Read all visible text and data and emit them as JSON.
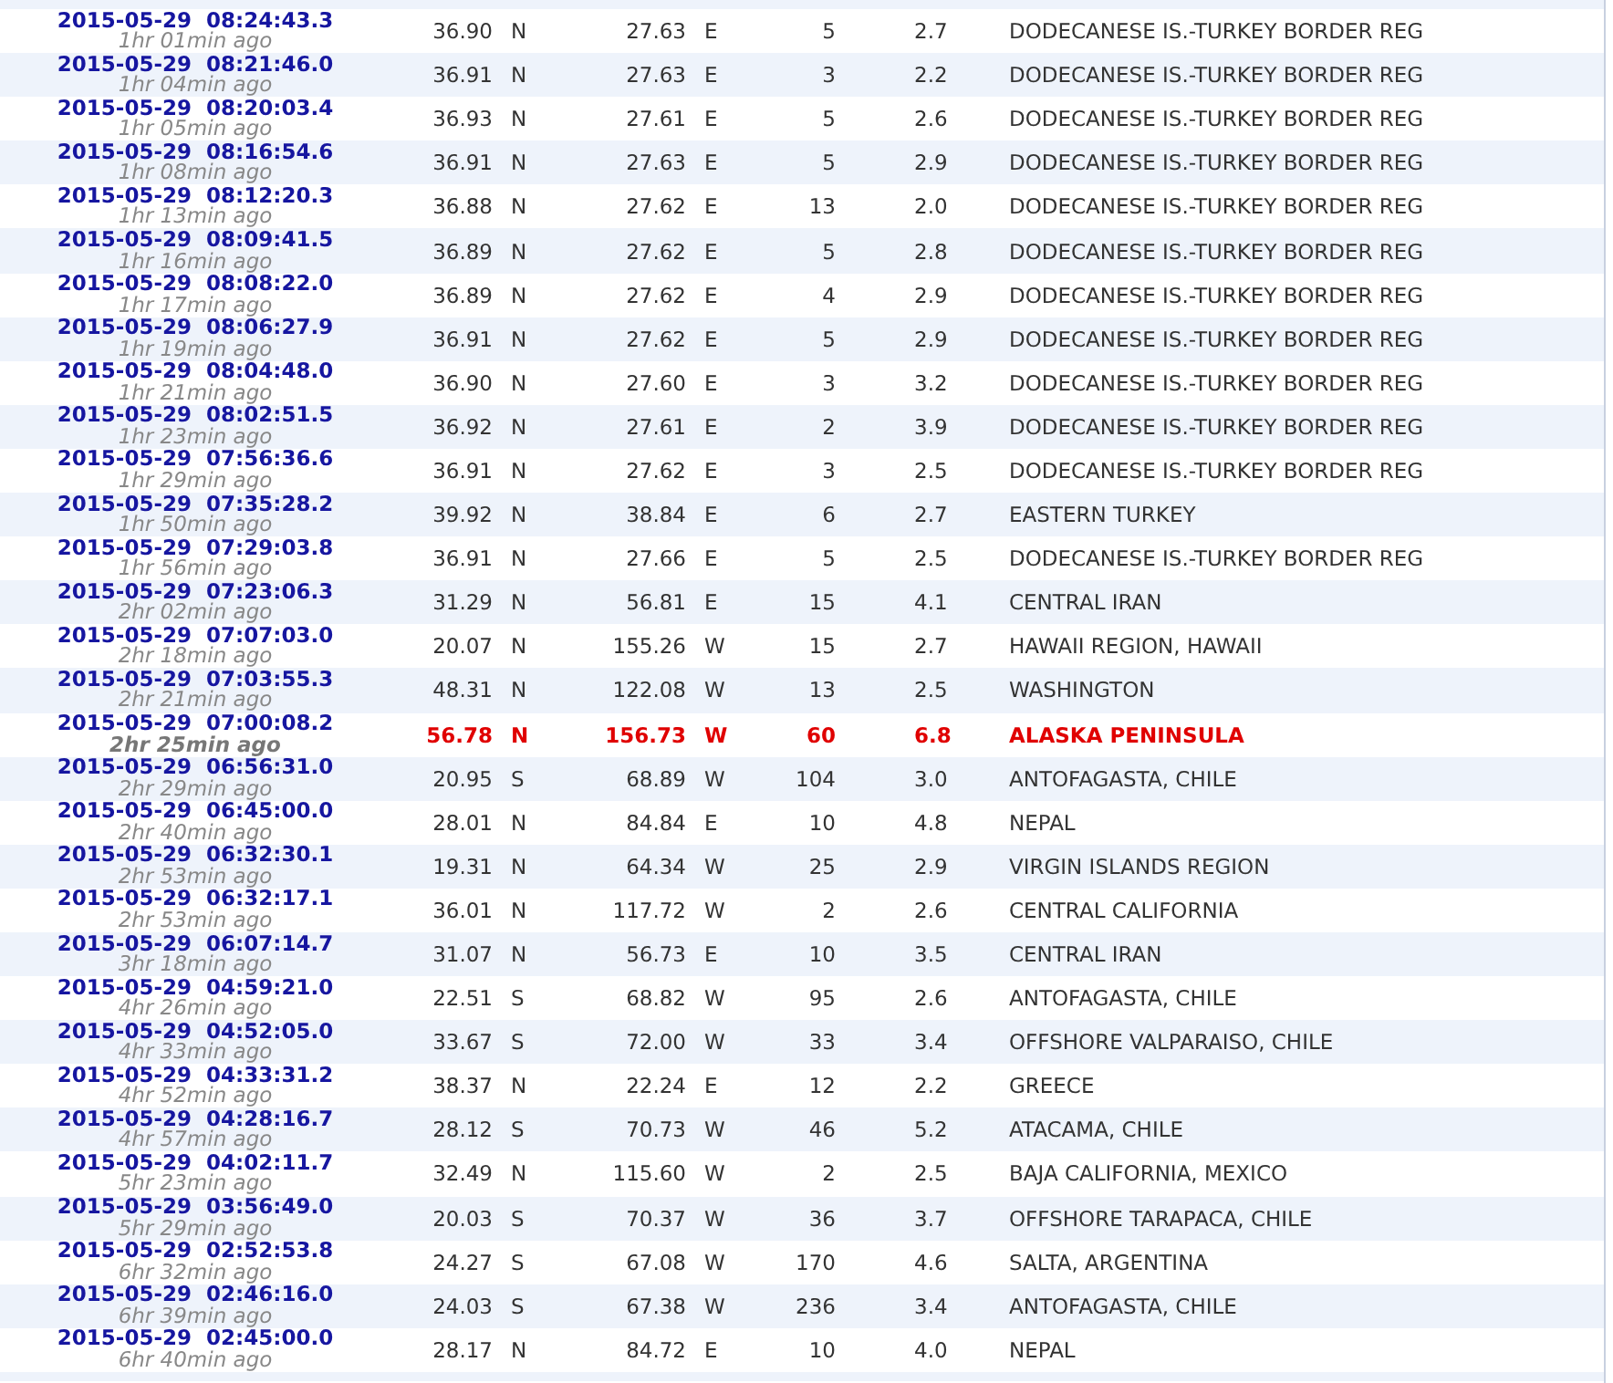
{
  "rows": [
    {
      "time": "2015-05-29  08:24:43.3",
      "ago": "1hr 01min ago",
      "lat": "36.90",
      "lat_dir": "N",
      "lon": "27.63",
      "lon_dir": "E",
      "depth": "5",
      "mag": "2.7",
      "region": "DODECANESE IS.-TURKEY BORDER REG",
      "highlighted": false
    },
    {
      "time": "2015-05-29  08:21:46.0",
      "ago": "1hr 04min ago",
      "lat": "36.91",
      "lat_dir": "N",
      "lon": "27.63",
      "lon_dir": "E",
      "depth": "3",
      "mag": "2.2",
      "region": "DODECANESE IS.-TURKEY BORDER REG",
      "highlighted": false
    },
    {
      "time": "2015-05-29  08:20:03.4",
      "ago": "1hr 05min ago",
      "lat": "36.93",
      "lat_dir": "N",
      "lon": "27.61",
      "lon_dir": "E",
      "depth": "5",
      "mag": "2.6",
      "region": "DODECANESE IS.-TURKEY BORDER REG",
      "highlighted": false
    },
    {
      "time": "2015-05-29  08:16:54.6",
      "ago": "1hr 08min ago",
      "lat": "36.91",
      "lat_dir": "N",
      "lon": "27.63",
      "lon_dir": "E",
      "depth": "5",
      "mag": "2.9",
      "region": "DODECANESE IS.-TURKEY BORDER REG",
      "highlighted": false
    },
    {
      "time": "2015-05-29  08:12:20.3",
      "ago": "1hr 13min ago",
      "lat": "36.88",
      "lat_dir": "N",
      "lon": "27.62",
      "lon_dir": "E",
      "depth": "13",
      "mag": "2.0",
      "region": "DODECANESE IS.-TURKEY BORDER REG",
      "highlighted": false
    },
    {
      "time": "2015-05-29  08:09:41.5",
      "ago": "1hr 16min ago",
      "lat": "36.89",
      "lat_dir": "N",
      "lon": "27.62",
      "lon_dir": "E",
      "depth": "5",
      "mag": "2.8",
      "region": "DODECANESE IS.-TURKEY BORDER REG",
      "highlighted": false
    },
    {
      "time": "2015-05-29  08:08:22.0",
      "ago": "1hr 17min ago",
      "lat": "36.89",
      "lat_dir": "N",
      "lon": "27.62",
      "lon_dir": "E",
      "depth": "4",
      "mag": "2.9",
      "region": "DODECANESE IS.-TURKEY BORDER REG",
      "highlighted": false
    },
    {
      "time": "2015-05-29  08:06:27.9",
      "ago": "1hr 19min ago",
      "lat": "36.91",
      "lat_dir": "N",
      "lon": "27.62",
      "lon_dir": "E",
      "depth": "5",
      "mag": "2.9",
      "region": "DODECANESE IS.-TURKEY BORDER REG",
      "highlighted": false
    },
    {
      "time": "2015-05-29  08:04:48.0",
      "ago": "1hr 21min ago",
      "lat": "36.90",
      "lat_dir": "N",
      "lon": "27.60",
      "lon_dir": "E",
      "depth": "3",
      "mag": "3.2",
      "region": "DODECANESE IS.-TURKEY BORDER REG",
      "highlighted": false
    },
    {
      "time": "2015-05-29  08:02:51.5",
      "ago": "1hr 23min ago",
      "lat": "36.92",
      "lat_dir": "N",
      "lon": "27.61",
      "lon_dir": "E",
      "depth": "2",
      "mag": "3.9",
      "region": "DODECANESE IS.-TURKEY BORDER REG",
      "highlighted": false
    },
    {
      "time": "2015-05-29  07:56:36.6",
      "ago": "1hr 29min ago",
      "lat": "36.91",
      "lat_dir": "N",
      "lon": "27.62",
      "lon_dir": "E",
      "depth": "3",
      "mag": "2.5",
      "region": "DODECANESE IS.-TURKEY BORDER REG",
      "highlighted": false
    },
    {
      "time": "2015-05-29  07:35:28.2",
      "ago": "1hr 50min ago",
      "lat": "39.92",
      "lat_dir": "N",
      "lon": "38.84",
      "lon_dir": "E",
      "depth": "6",
      "mag": "2.7",
      "region": "EASTERN TURKEY",
      "highlighted": false
    },
    {
      "time": "2015-05-29  07:29:03.8",
      "ago": "1hr 56min ago",
      "lat": "36.91",
      "lat_dir": "N",
      "lon": "27.66",
      "lon_dir": "E",
      "depth": "5",
      "mag": "2.5",
      "region": "DODECANESE IS.-TURKEY BORDER REG",
      "highlighted": false
    },
    {
      "time": "2015-05-29  07:23:06.3",
      "ago": "2hr 02min ago",
      "lat": "31.29",
      "lat_dir": "N",
      "lon": "56.81",
      "lon_dir": "E",
      "depth": "15",
      "mag": "4.1",
      "region": "CENTRAL IRAN",
      "highlighted": false
    },
    {
      "time": "2015-05-29  07:07:03.0",
      "ago": "2hr 18min ago",
      "lat": "20.07",
      "lat_dir": "N",
      "lon": "155.26",
      "lon_dir": "W",
      "depth": "15",
      "mag": "2.7",
      "region": "HAWAII REGION, HAWAII",
      "highlighted": false
    },
    {
      "time": "2015-05-29  07:03:55.3",
      "ago": "2hr 21min ago",
      "lat": "48.31",
      "lat_dir": "N",
      "lon": "122.08",
      "lon_dir": "W",
      "depth": "13",
      "mag": "2.5",
      "region": "WASHINGTON",
      "highlighted": false
    },
    {
      "time": "2015-05-29  07:00:08.2",
      "ago": "2hr 25min ago",
      "lat": "56.78",
      "lat_dir": "N",
      "lon": "156.73",
      "lon_dir": "W",
      "depth": "60",
      "mag": "6.8",
      "region": "ALASKA PENINSULA",
      "highlighted": true
    },
    {
      "time": "2015-05-29  06:56:31.0",
      "ago": "2hr 29min ago",
      "lat": "20.95",
      "lat_dir": "S",
      "lon": "68.89",
      "lon_dir": "W",
      "depth": "104",
      "mag": "3.0",
      "region": "ANTOFAGASTA, CHILE",
      "highlighted": false
    },
    {
      "time": "2015-05-29  06:45:00.0",
      "ago": "2hr 40min ago",
      "lat": "28.01",
      "lat_dir": "N",
      "lon": "84.84",
      "lon_dir": "E",
      "depth": "10",
      "mag": "4.8",
      "region": "NEPAL",
      "highlighted": false
    },
    {
      "time": "2015-05-29  06:32:30.1",
      "ago": "2hr 53min ago",
      "lat": "19.31",
      "lat_dir": "N",
      "lon": "64.34",
      "lon_dir": "W",
      "depth": "25",
      "mag": "2.9",
      "region": "VIRGIN ISLANDS REGION",
      "highlighted": false
    },
    {
      "time": "2015-05-29  06:32:17.1",
      "ago": "2hr 53min ago",
      "lat": "36.01",
      "lat_dir": "N",
      "lon": "117.72",
      "lon_dir": "W",
      "depth": "2",
      "mag": "2.6",
      "region": "CENTRAL CALIFORNIA",
      "highlighted": false
    },
    {
      "time": "2015-05-29  06:07:14.7",
      "ago": "3hr 18min ago",
      "lat": "31.07",
      "lat_dir": "N",
      "lon": "56.73",
      "lon_dir": "E",
      "depth": "10",
      "mag": "3.5",
      "region": "CENTRAL IRAN",
      "highlighted": false
    },
    {
      "time": "2015-05-29  04:59:21.0",
      "ago": "4hr 26min ago",
      "lat": "22.51",
      "lat_dir": "S",
      "lon": "68.82",
      "lon_dir": "W",
      "depth": "95",
      "mag": "2.6",
      "region": "ANTOFAGASTA, CHILE",
      "highlighted": false
    },
    {
      "time": "2015-05-29  04:52:05.0",
      "ago": "4hr 33min ago",
      "lat": "33.67",
      "lat_dir": "S",
      "lon": "72.00",
      "lon_dir": "W",
      "depth": "33",
      "mag": "3.4",
      "region": "OFFSHORE VALPARAISO, CHILE",
      "highlighted": false
    },
    {
      "time": "2015-05-29  04:33:31.2",
      "ago": "4hr 52min ago",
      "lat": "38.37",
      "lat_dir": "N",
      "lon": "22.24",
      "lon_dir": "E",
      "depth": "12",
      "mag": "2.2",
      "region": "GREECE",
      "highlighted": false
    },
    {
      "time": "2015-05-29  04:28:16.7",
      "ago": "4hr 57min ago",
      "lat": "28.12",
      "lat_dir": "S",
      "lon": "70.73",
      "lon_dir": "W",
      "depth": "46",
      "mag": "5.2",
      "region": "ATACAMA, CHILE",
      "highlighted": false
    },
    {
      "time": "2015-05-29  04:02:11.7",
      "ago": "5hr 23min ago",
      "lat": "32.49",
      "lat_dir": "N",
      "lon": "115.60",
      "lon_dir": "W",
      "depth": "2",
      "mag": "2.5",
      "region": "BAJA CALIFORNIA, MEXICO",
      "highlighted": false
    },
    {
      "time": "2015-05-29  03:56:49.0",
      "ago": "5hr 29min ago",
      "lat": "20.03",
      "lat_dir": "S",
      "lon": "70.37",
      "lon_dir": "W",
      "depth": "36",
      "mag": "3.7",
      "region": "OFFSHORE TARAPACA, CHILE",
      "highlighted": false
    },
    {
      "time": "2015-05-29  02:52:53.8",
      "ago": "6hr 32min ago",
      "lat": "24.27",
      "lat_dir": "S",
      "lon": "67.08",
      "lon_dir": "W",
      "depth": "170",
      "mag": "4.6",
      "region": "SALTA, ARGENTINA",
      "highlighted": false
    },
    {
      "time": "2015-05-29  02:46:16.0",
      "ago": "6hr 39min ago",
      "lat": "24.03",
      "lat_dir": "S",
      "lon": "67.38",
      "lon_dir": "W",
      "depth": "236",
      "mag": "3.4",
      "region": "ANTOFAGASTA, CHILE",
      "highlighted": false
    },
    {
      "time": "2015-05-29  02:45:00.0",
      "ago": "6hr 40min ago",
      "lat": "28.17",
      "lat_dir": "N",
      "lon": "84.72",
      "lon_dir": "E",
      "depth": "10",
      "mag": "4.0",
      "region": "NEPAL",
      "highlighted": false
    }
  ]
}
